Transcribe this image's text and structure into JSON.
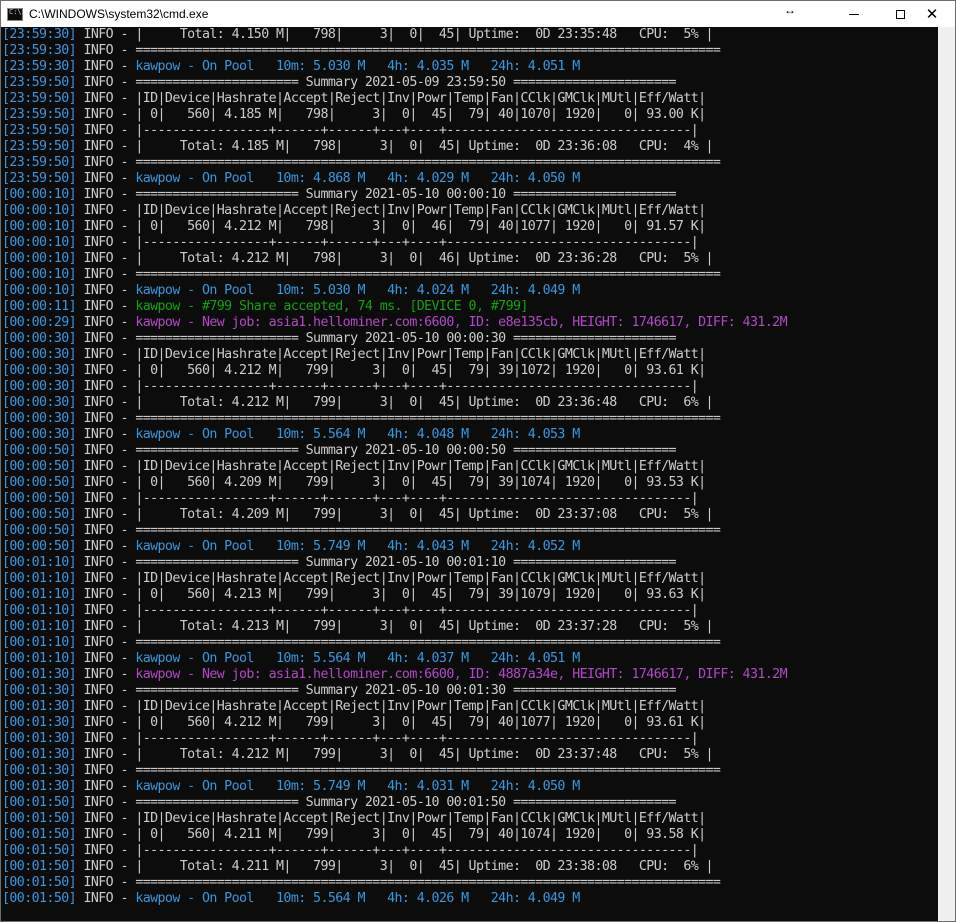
{
  "window": {
    "title": "C:\\WINDOWS\\system32\\cmd.exe",
    "resize_glyph": "↔",
    "close_glyph": "✕"
  },
  "console": {
    "level": "INFO",
    "lines": [
      {
        "ts": "[23:59:30]",
        "kind": "summary",
        "text": "|     Total: 4.150 M|   798|     3|  0|  45| Uptime:  0D 23:35:48   CPU:  5% |"
      },
      {
        "ts": "[23:59:30]",
        "kind": "summary",
        "text": "==============================================================================="
      },
      {
        "ts": "[23:59:30]",
        "kind": "pool",
        "text": "kawpow - On Pool   10m: 5.030 M   4h: 4.035 M   24h: 4.051 M"
      },
      {
        "ts": "[23:59:50]",
        "kind": "summary",
        "text": "====================== Summary 2021-05-09 23:59:50 ======================"
      },
      {
        "ts": "[23:59:50]",
        "kind": "summary",
        "text": "|ID|Device|Hashrate|Accept|Reject|Inv|Powr|Temp|Fan|CClk|GMClk|MUtl|Eff/Watt|"
      },
      {
        "ts": "[23:59:50]",
        "kind": "summary",
        "text": "| 0|   560| 4.185 M|   798|     3|  0|  45|  79| 40|1070| 1920|   0| 93.00 K|"
      },
      {
        "ts": "[23:59:50]",
        "kind": "summary",
        "text": "|-----------------+------+------+---+----+---------------------------------|"
      },
      {
        "ts": "[23:59:50]",
        "kind": "summary",
        "text": "|     Total: 4.185 M|   798|     3|  0|  45| Uptime:  0D 23:36:08   CPU:  4% |"
      },
      {
        "ts": "[23:59:50]",
        "kind": "summary",
        "text": "==============================================================================="
      },
      {
        "ts": "[23:59:50]",
        "kind": "pool",
        "text": "kawpow - On Pool   10m: 4.868 M   4h: 4.029 M   24h: 4.050 M"
      },
      {
        "ts": "[00:00:10]",
        "kind": "summary",
        "text": "====================== Summary 2021-05-10 00:00:10 ======================"
      },
      {
        "ts": "[00:00:10]",
        "kind": "summary",
        "text": "|ID|Device|Hashrate|Accept|Reject|Inv|Powr|Temp|Fan|CClk|GMClk|MUtl|Eff/Watt|"
      },
      {
        "ts": "[00:00:10]",
        "kind": "summary",
        "text": "| 0|   560| 4.212 M|   798|     3|  0|  46|  79| 40|1077| 1920|   0| 91.57 K|"
      },
      {
        "ts": "[00:00:10]",
        "kind": "summary",
        "text": "|-----------------+------+------+---+----+---------------------------------|"
      },
      {
        "ts": "[00:00:10]",
        "kind": "summary",
        "text": "|     Total: 4.212 M|   798|     3|  0|  46| Uptime:  0D 23:36:28   CPU:  5% |"
      },
      {
        "ts": "[00:00:10]",
        "kind": "summary",
        "text": "==============================================================================="
      },
      {
        "ts": "[00:00:10]",
        "kind": "pool",
        "text": "kawpow - On Pool   10m: 5.030 M   4h: 4.024 M   24h: 4.049 M"
      },
      {
        "ts": "[00:00:11]",
        "kind": "share",
        "text": "kawpow - #799 Share accepted, 74 ms. [DEVICE 0, #799]"
      },
      {
        "ts": "[00:00:29]",
        "kind": "job",
        "text": "kawpow - New job: asia1.hellominer.com:6600, ID: e8e135cb, HEIGHT: 1746617, DIFF: 431.2M"
      },
      {
        "ts": "[00:00:30]",
        "kind": "summary",
        "text": "====================== Summary 2021-05-10 00:00:30 ======================"
      },
      {
        "ts": "[00:00:30]",
        "kind": "summary",
        "text": "|ID|Device|Hashrate|Accept|Reject|Inv|Powr|Temp|Fan|CClk|GMClk|MUtl|Eff/Watt|"
      },
      {
        "ts": "[00:00:30]",
        "kind": "summary",
        "text": "| 0|   560| 4.212 M|   799|     3|  0|  45|  79| 39|1072| 1920|   0| 93.61 K|"
      },
      {
        "ts": "[00:00:30]",
        "kind": "summary",
        "text": "|-----------------+------+------+---+----+---------------------------------|"
      },
      {
        "ts": "[00:00:30]",
        "kind": "summary",
        "text": "|     Total: 4.212 M|   799|     3|  0|  45| Uptime:  0D 23:36:48   CPU:  6% |"
      },
      {
        "ts": "[00:00:30]",
        "kind": "summary",
        "text": "==============================================================================="
      },
      {
        "ts": "[00:00:30]",
        "kind": "pool",
        "text": "kawpow - On Pool   10m: 5.564 M   4h: 4.048 M   24h: 4.053 M"
      },
      {
        "ts": "[00:00:50]",
        "kind": "summary",
        "text": "====================== Summary 2021-05-10 00:00:50 ======================"
      },
      {
        "ts": "[00:00:50]",
        "kind": "summary",
        "text": "|ID|Device|Hashrate|Accept|Reject|Inv|Powr|Temp|Fan|CClk|GMClk|MUtl|Eff/Watt|"
      },
      {
        "ts": "[00:00:50]",
        "kind": "summary",
        "text": "| 0|   560| 4.209 M|   799|     3|  0|  45|  79| 39|1074| 1920|   0| 93.53 K|"
      },
      {
        "ts": "[00:00:50]",
        "kind": "summary",
        "text": "|-----------------+------+------+---+----+---------------------------------|"
      },
      {
        "ts": "[00:00:50]",
        "kind": "summary",
        "text": "|     Total: 4.209 M|   799|     3|  0|  45| Uptime:  0D 23:37:08   CPU:  5% |"
      },
      {
        "ts": "[00:00:50]",
        "kind": "summary",
        "text": "==============================================================================="
      },
      {
        "ts": "[00:00:50]",
        "kind": "pool",
        "text": "kawpow - On Pool   10m: 5.749 M   4h: 4.043 M   24h: 4.052 M"
      },
      {
        "ts": "[00:01:10]",
        "kind": "summary",
        "text": "====================== Summary 2021-05-10 00:01:10 ======================"
      },
      {
        "ts": "[00:01:10]",
        "kind": "summary",
        "text": "|ID|Device|Hashrate|Accept|Reject|Inv|Powr|Temp|Fan|CClk|GMClk|MUtl|Eff/Watt|"
      },
      {
        "ts": "[00:01:10]",
        "kind": "summary",
        "text": "| 0|   560| 4.213 M|   799|     3|  0|  45|  79| 39|1079| 1920|   0| 93.63 K|"
      },
      {
        "ts": "[00:01:10]",
        "kind": "summary",
        "text": "|-----------------+------+------+---+----+---------------------------------|"
      },
      {
        "ts": "[00:01:10]",
        "kind": "summary",
        "text": "|     Total: 4.213 M|   799|     3|  0|  45| Uptime:  0D 23:37:28   CPU:  5% |"
      },
      {
        "ts": "[00:01:10]",
        "kind": "summary",
        "text": "==============================================================================="
      },
      {
        "ts": "[00:01:10]",
        "kind": "pool",
        "text": "kawpow - On Pool   10m: 5.564 M   4h: 4.037 M   24h: 4.051 M"
      },
      {
        "ts": "[00:01:30]",
        "kind": "job",
        "text": "kawpow - New job: asia1.hellominer.com:6600, ID: 4887a34e, HEIGHT: 1746617, DIFF: 431.2M"
      },
      {
        "ts": "[00:01:30]",
        "kind": "summary",
        "text": "====================== Summary 2021-05-10 00:01:30 ======================"
      },
      {
        "ts": "[00:01:30]",
        "kind": "summary",
        "text": "|ID|Device|Hashrate|Accept|Reject|Inv|Powr|Temp|Fan|CClk|GMClk|MUtl|Eff/Watt|"
      },
      {
        "ts": "[00:01:30]",
        "kind": "summary",
        "text": "| 0|   560| 4.212 M|   799|     3|  0|  45|  79| 40|1077| 1920|   0| 93.61 K|"
      },
      {
        "ts": "[00:01:30]",
        "kind": "summary",
        "text": "|-----------------+------+------+---+----+---------------------------------|"
      },
      {
        "ts": "[00:01:30]",
        "kind": "summary",
        "text": "|     Total: 4.212 M|   799|     3|  0|  45| Uptime:  0D 23:37:48   CPU:  5% |"
      },
      {
        "ts": "[00:01:30]",
        "kind": "summary",
        "text": "==============================================================================="
      },
      {
        "ts": "[00:01:30]",
        "kind": "pool",
        "text": "kawpow - On Pool   10m: 5.749 M   4h: 4.031 M   24h: 4.050 M"
      },
      {
        "ts": "[00:01:50]",
        "kind": "summary",
        "text": "====================== Summary 2021-05-10 00:01:50 ======================"
      },
      {
        "ts": "[00:01:50]",
        "kind": "summary",
        "text": "|ID|Device|Hashrate|Accept|Reject|Inv|Powr|Temp|Fan|CClk|GMClk|MUtl|Eff/Watt|"
      },
      {
        "ts": "[00:01:50]",
        "kind": "summary",
        "text": "| 0|   560| 4.211 M|   799|     3|  0|  45|  79| 40|1074| 1920|   0| 93.58 K|"
      },
      {
        "ts": "[00:01:50]",
        "kind": "summary",
        "text": "|-----------------+------+------+---+----+---------------------------------|"
      },
      {
        "ts": "[00:01:50]",
        "kind": "summary",
        "text": "|     Total: 4.211 M|   799|     3|  0|  45| Uptime:  0D 23:38:08   CPU:  6% |"
      },
      {
        "ts": "[00:01:50]",
        "kind": "summary",
        "text": "==============================================================================="
      },
      {
        "ts": "[00:01:50]",
        "kind": "pool",
        "text": "kawpow - On Pool   10m: 5.564 M   4h: 4.026 M   24h: 4.049 M"
      }
    ]
  }
}
